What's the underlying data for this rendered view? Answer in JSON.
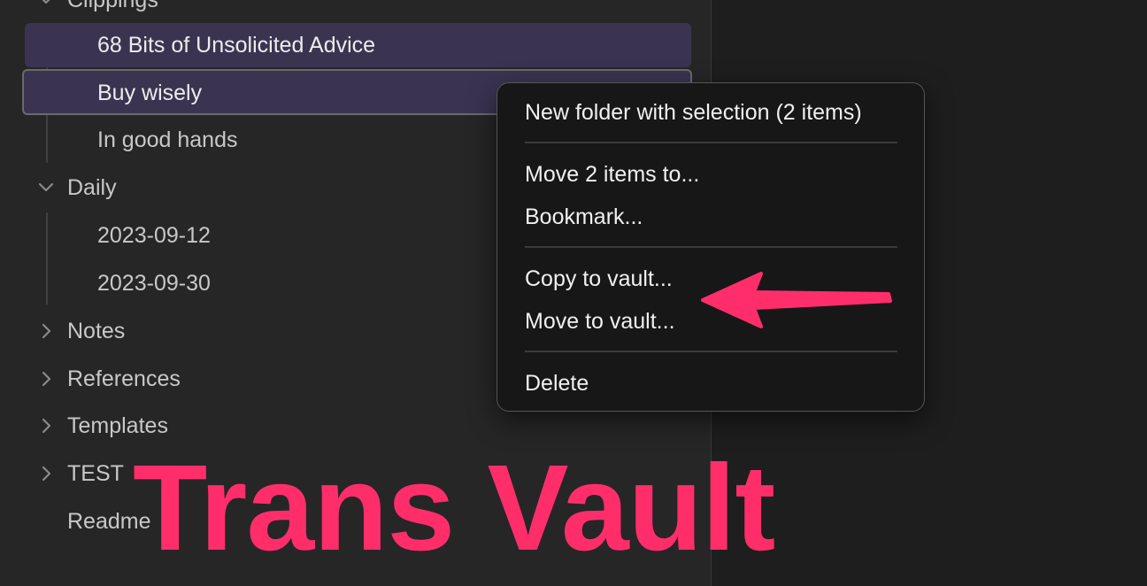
{
  "file_tree": {
    "partial_folder": "Clippings",
    "clippings_items": [
      {
        "label": "68 Bits of Unsolicited Advice"
      },
      {
        "label": "Buy wisely"
      },
      {
        "label": "In good hands"
      }
    ],
    "daily": {
      "label": "Daily",
      "items": [
        {
          "label": "2023-09-12"
        },
        {
          "label": "2023-09-30"
        }
      ]
    },
    "folders": [
      {
        "label": "Notes"
      },
      {
        "label": "References"
      },
      {
        "label": "Templates"
      },
      {
        "label": "TEST"
      }
    ],
    "root_file": "Readme"
  },
  "context_menu": {
    "new_folder": "New folder with selection (2 items)",
    "move_items": "Move 2 items to...",
    "bookmark": "Bookmark...",
    "copy_to_vault": "Copy to vault...",
    "move_to_vault": "Move to vault...",
    "delete": "Delete"
  },
  "annotation": {
    "title": "Trans Vault",
    "color": "#ff2e6b"
  },
  "colors": {
    "selection": "#3b3451",
    "menu_bg": "#171717",
    "sidebar_bg": "#262626"
  }
}
